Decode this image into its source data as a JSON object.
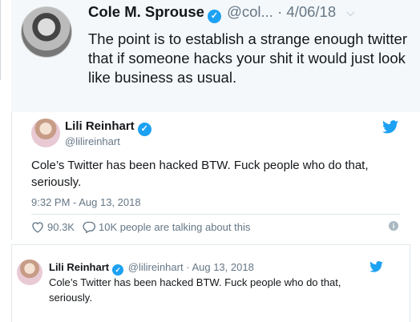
{
  "tweet1": {
    "name": "Cole M. Sprouse",
    "verified": "✓",
    "handle": "@col...",
    "separator": "·",
    "date": "4/06/18",
    "chevron": "⌵",
    "text": "The point is to establish a strange enough twitter that if someone hacks your shit it would just look like business as usual."
  },
  "tweet2": {
    "name": "Lili Reinhart",
    "verified": "✓",
    "handle": "@lilireinhart",
    "text": "Cole’s Twitter has been hacked BTW. Fuck people who do that, seriously.",
    "time": "9:32 PM - Aug 13, 2018",
    "likes": "90.3K",
    "talking": "10K people are talking about this",
    "info": "i"
  },
  "tweet3": {
    "name": "Lili Reinhart",
    "verified": "✓",
    "handle": "@lilireinhart",
    "separator": "·",
    "date": "Aug 13, 2018",
    "text": "Cole’s Twitter has been hacked BTW. Fuck people who do that, seriously."
  },
  "colors": {
    "accent": "#1da1f2",
    "muted": "#657786",
    "text": "#14171a",
    "bg_highlight": "#f5f8fa"
  },
  "icons": [
    "verified-badge-icon",
    "chevron-down-icon",
    "twitter-bird-icon",
    "heart-icon",
    "comment-icon",
    "info-icon"
  ]
}
